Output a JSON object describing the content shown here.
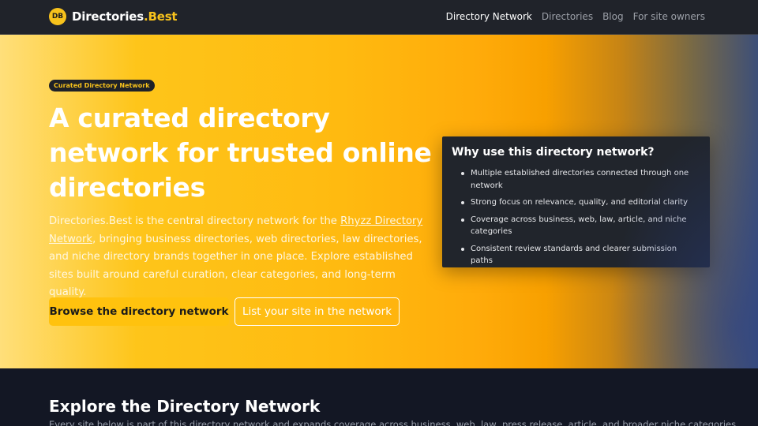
{
  "nav": {
    "logo_initials": "DB",
    "brand_name": "Directories",
    "brand_suffix": ".Best",
    "links": [
      {
        "label": "Directory Network",
        "active": true
      },
      {
        "label": "Directories",
        "active": false
      },
      {
        "label": "Blog",
        "active": false
      },
      {
        "label": "For site owners",
        "active": false
      }
    ]
  },
  "hero": {
    "badge": "Curated Directory Network",
    "headline": "A curated directory network for trusted online directories",
    "lead_before": "Directories.Best is the central directory network for the ",
    "lead_link": "Rhyzz Directory Network",
    "lead_after": ", bringing business directories, web directories, law directories, and niche directory brands together in one place. Explore established sites built around careful curation, clear categories, and long-term quality.",
    "primary_button": "Browse the directory network",
    "secondary_button": "List your site in the network"
  },
  "card": {
    "title": "Why use this directory network?",
    "items": [
      "Multiple established directories connected through one network",
      "Strong focus on relevance, quality, and editorial clarity",
      "Coverage across business, web, law, article, and niche categories",
      "Consistent review standards and clearer submission paths"
    ]
  },
  "explore": {
    "title": "Explore the Directory Network",
    "subtitle": "Every site below is part of this directory network and expands coverage across business, web, law, press release, article, and broader niche categories."
  },
  "colors": {
    "accent": "#f7c21c",
    "navbar_bg": "#20232a",
    "card_bg": "#21252c",
    "section_bg": "#131724"
  }
}
